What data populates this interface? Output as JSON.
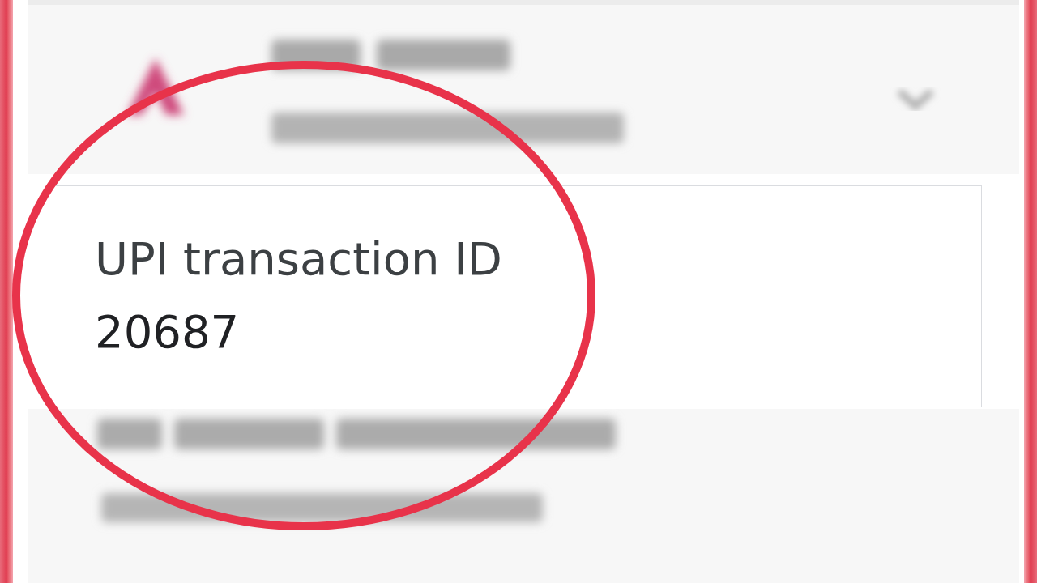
{
  "transaction_id_card": {
    "label": "UPI transaction ID",
    "value": "20687"
  }
}
